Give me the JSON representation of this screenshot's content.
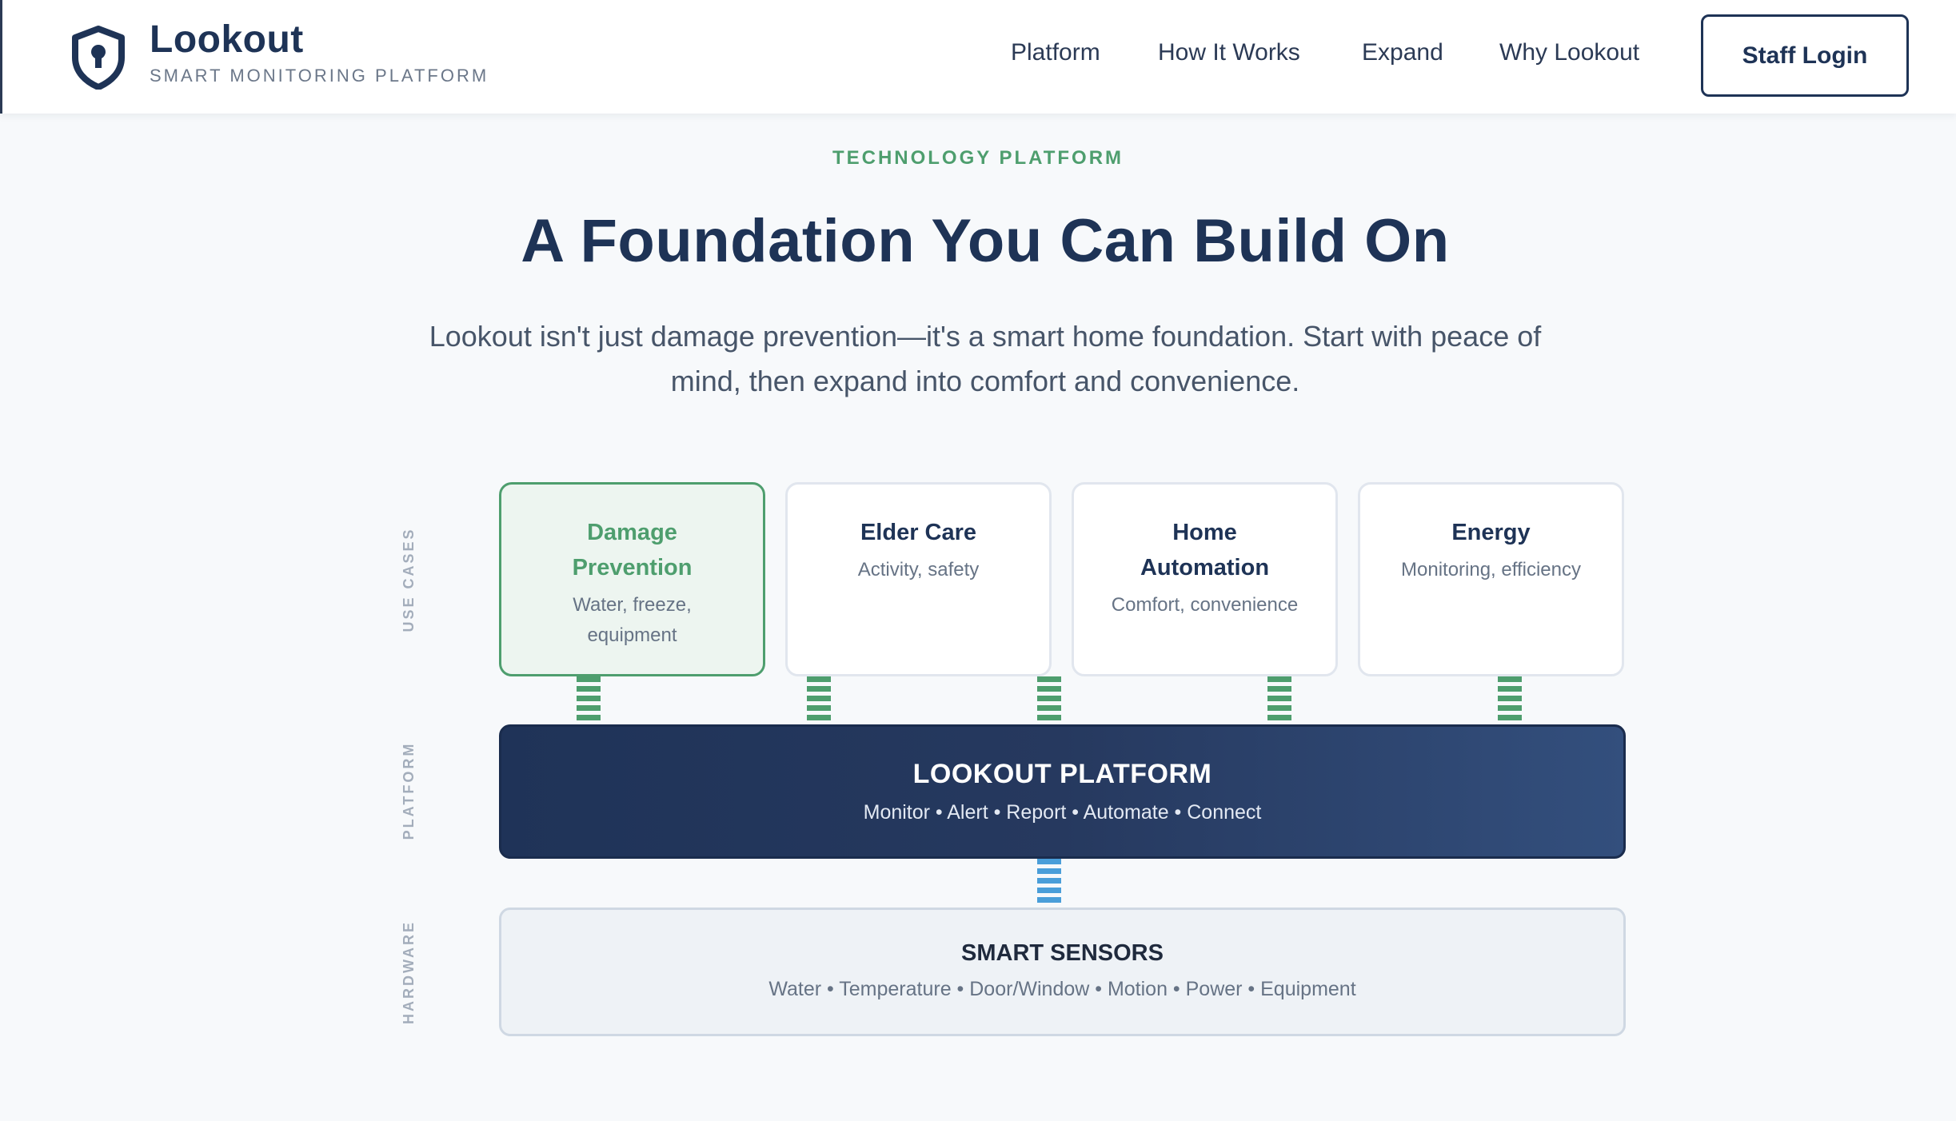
{
  "header": {
    "brand_name": "Lookout",
    "brand_tagline": "SMART MONITORING PLATFORM",
    "nav": [
      "Platform",
      "How It Works",
      "Expand",
      "Why Lookout"
    ],
    "login_label": "Staff Login"
  },
  "hero": {
    "eyebrow": "TECHNOLOGY PLATFORM",
    "title": "A Foundation You Can Build On",
    "subtitle": "Lookout isn't just damage prevention—it's a smart home foundation. Start with peace of mind, then expand into comfort and convenience."
  },
  "diagram": {
    "layer_labels": {
      "use_cases": "USE CASES",
      "platform": "PLATFORM",
      "hardware": "HARDWARE"
    },
    "use_cases": [
      {
        "title": "Damage Prevention",
        "desc": "Water, freeze, equipment",
        "active": true
      },
      {
        "title": "Elder Care",
        "desc": "Activity, safety",
        "active": false
      },
      {
        "title": "Home Automation",
        "desc": "Comfort, convenience",
        "active": false
      },
      {
        "title": "Energy",
        "desc": "Monitoring, efficiency",
        "active": false
      }
    ],
    "platform": {
      "title": "LOOKOUT PLATFORM",
      "items": "Monitor • Alert • Report • Automate • Connect"
    },
    "sensors": {
      "title": "SMART SENSORS",
      "items": "Water • Temperature • Door/Window • Motion • Power • Equipment"
    }
  },
  "colors": {
    "navy": "#1e3356",
    "green_accent": "#4e9e6e",
    "blue_connector": "#4a9ed9"
  },
  "icons": {
    "logo": "shield-icon"
  }
}
